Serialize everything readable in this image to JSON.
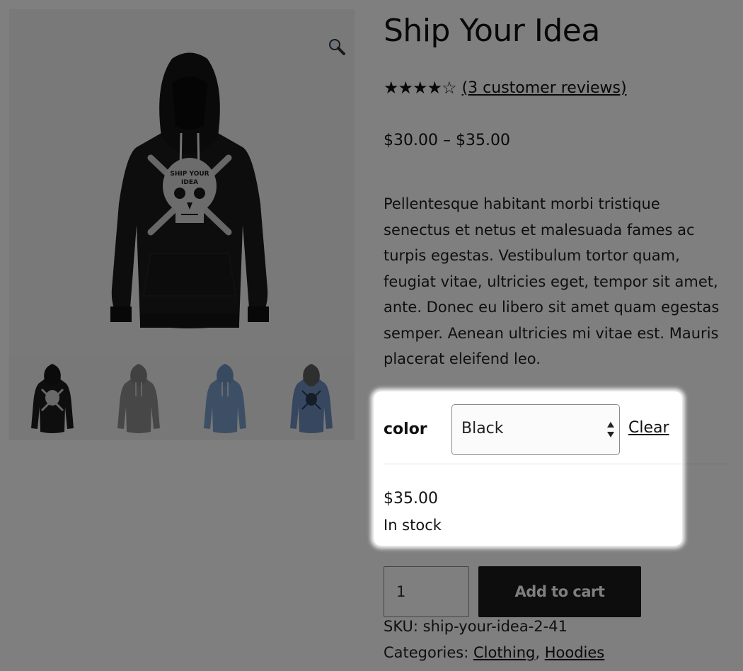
{
  "product": {
    "title": "Ship Your Idea",
    "rating_stars": "★★★★☆",
    "rating_value": 4,
    "rating_max": 5,
    "reviews_link": "(3 customer reviews)",
    "price_range": "$30.00 – $35.00",
    "description": "Pellentesque habitant morbi tristique senectus et netus et malesuada fames ac turpis egestas. Vestibulum tortor quam, feugiat vitae, ultricies eget, tempor sit amet, ante. Donec eu libero sit amet quam egestas semper. Aenean ultricies mi vitae est. Mauris placerat eleifend leo."
  },
  "gallery": {
    "zoom_icon": "magnifier-icon",
    "thumbnails": [
      {
        "color": "#1c1c1c"
      },
      {
        "color": "#8e8e8e"
      },
      {
        "color": "#7b9ec8"
      },
      {
        "color": "#6d8fbe"
      }
    ]
  },
  "variation": {
    "label": "color",
    "selected": "Black",
    "clear_label": "Clear"
  },
  "variant": {
    "price": "$35.00",
    "stock": "In stock"
  },
  "cart": {
    "quantity": "1",
    "add_label": "Add to cart"
  },
  "meta": {
    "sku_label": "SKU:",
    "sku": "ship-your-idea-2-41",
    "categories_label": "Categories:",
    "categories": [
      "Clothing",
      "Hoodies"
    ]
  }
}
